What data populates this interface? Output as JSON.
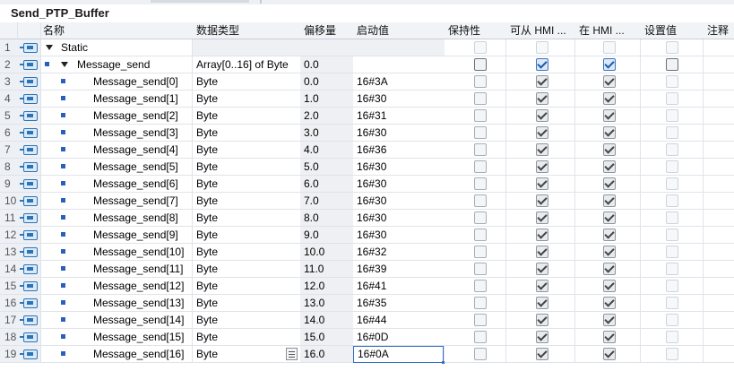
{
  "title": "Send_PTP_Buffer",
  "columns": {
    "name": "名称",
    "datatype": "数据类型",
    "offset": "偏移量",
    "start_value": "启动值",
    "retain": "保持性",
    "hmi_accessible": "可从 HMI ...",
    "hmi_visible": "在 HMI ...",
    "setpoint": "设置值",
    "comment": "注释"
  },
  "rows": [
    {
      "num": "1",
      "name": "Static",
      "type": "",
      "offset": "",
      "start": "",
      "kind": "section"
    },
    {
      "num": "2",
      "name": "Message_send",
      "type": "Array[0..16] of Byte",
      "offset": "0.0",
      "start": "",
      "kind": "array"
    },
    {
      "num": "3",
      "name": "Message_send[0]",
      "type": "Byte",
      "offset": "0.0",
      "start": "16#3A",
      "kind": "elem"
    },
    {
      "num": "4",
      "name": "Message_send[1]",
      "type": "Byte",
      "offset": "1.0",
      "start": "16#30",
      "kind": "elem"
    },
    {
      "num": "5",
      "name": "Message_send[2]",
      "type": "Byte",
      "offset": "2.0",
      "start": "16#31",
      "kind": "elem"
    },
    {
      "num": "6",
      "name": "Message_send[3]",
      "type": "Byte",
      "offset": "3.0",
      "start": "16#30",
      "kind": "elem"
    },
    {
      "num": "7",
      "name": "Message_send[4]",
      "type": "Byte",
      "offset": "4.0",
      "start": "16#36",
      "kind": "elem"
    },
    {
      "num": "8",
      "name": "Message_send[5]",
      "type": "Byte",
      "offset": "5.0",
      "start": "16#30",
      "kind": "elem"
    },
    {
      "num": "9",
      "name": "Message_send[6]",
      "type": "Byte",
      "offset": "6.0",
      "start": "16#30",
      "kind": "elem"
    },
    {
      "num": "10",
      "name": "Message_send[7]",
      "type": "Byte",
      "offset": "7.0",
      "start": "16#30",
      "kind": "elem"
    },
    {
      "num": "11",
      "name": "Message_send[8]",
      "type": "Byte",
      "offset": "8.0",
      "start": "16#30",
      "kind": "elem"
    },
    {
      "num": "12",
      "name": "Message_send[9]",
      "type": "Byte",
      "offset": "9.0",
      "start": "16#30",
      "kind": "elem"
    },
    {
      "num": "13",
      "name": "Message_send[10]",
      "type": "Byte",
      "offset": "10.0",
      "start": "16#32",
      "kind": "elem"
    },
    {
      "num": "14",
      "name": "Message_send[11]",
      "type": "Byte",
      "offset": "11.0",
      "start": "16#39",
      "kind": "elem"
    },
    {
      "num": "15",
      "name": "Message_send[12]",
      "type": "Byte",
      "offset": "12.0",
      "start": "16#41",
      "kind": "elem"
    },
    {
      "num": "16",
      "name": "Message_send[13]",
      "type": "Byte",
      "offset": "13.0",
      "start": "16#35",
      "kind": "elem"
    },
    {
      "num": "17",
      "name": "Message_send[14]",
      "type": "Byte",
      "offset": "14.0",
      "start": "16#44",
      "kind": "elem"
    },
    {
      "num": "18",
      "name": "Message_send[15]",
      "type": "Byte",
      "offset": "15.0",
      "start": "16#0D",
      "kind": "elem"
    },
    {
      "num": "19",
      "name": "Message_send[16]",
      "type": "Byte",
      "offset": "16.0",
      "start": "16#0A",
      "kind": "edit"
    }
  ]
}
